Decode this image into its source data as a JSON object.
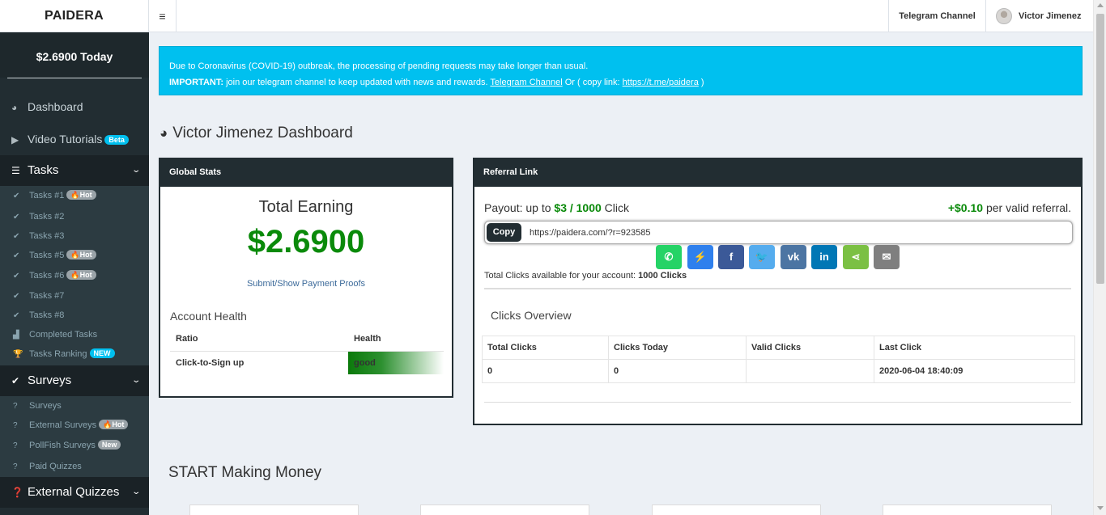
{
  "header": {
    "brand": "PAIDERA",
    "menu_icon": "hamburger-icon",
    "telegram_channel": "Telegram Channel",
    "user_name": "Victor Jimenez"
  },
  "sidebar": {
    "balance": "$2.6900 Today",
    "dashboard": "Dashboard",
    "video_tutorials": "Video Tutorials",
    "video_badge": "Beta",
    "tasks_section": "Tasks",
    "tasks": [
      {
        "label": "Tasks #1",
        "badge": "Hot"
      },
      {
        "label": "Tasks #2",
        "badge": ""
      },
      {
        "label": "Tasks #3",
        "badge": ""
      },
      {
        "label": "Tasks #5",
        "badge": "Hot"
      },
      {
        "label": "Tasks #6",
        "badge": "Hot"
      },
      {
        "label": "Tasks #7",
        "badge": ""
      },
      {
        "label": "Tasks #8",
        "badge": ""
      },
      {
        "label": "Completed Tasks",
        "badge": ""
      },
      {
        "label": "Tasks Ranking",
        "badge": "NEW"
      }
    ],
    "surveys_section": "Surveys",
    "surveys": [
      {
        "label": "Surveys",
        "badge": ""
      },
      {
        "label": "External Surveys",
        "badge": "Hot"
      },
      {
        "label": "PollFish Surveys",
        "badge": "New"
      },
      {
        "label": "Paid Quizzes",
        "badge": ""
      }
    ],
    "external_quizzes_section": "External Quizzes",
    "colors": {
      "bg": "#222d32",
      "section_bg": "#1a2226",
      "badge_blue": "#00c0ef"
    }
  },
  "alert": {
    "line1": "Due to Coronavirus (COVID-19) outbreak, the processing of pending requests may take longer than usual.",
    "important_label": "IMPORTANT:",
    "line2_text": " join our telegram channel to keep updated with news and rewards. ",
    "telegram_link": "Telegram Channel",
    "copy_text": " Or ( copy link: ",
    "copy_link": "https://t.me/paidera",
    "close_paren": " )",
    "color": "#00c0ef"
  },
  "dashboard": {
    "title": "Victor Jimenez Dashboard"
  },
  "global_stats": {
    "header": "Global Stats",
    "total_earning_label": "Total Earning",
    "total_earning_value": "$2.6900",
    "proofs_link": "Submit/Show Payment Proofs",
    "account_health_title": "Account Health",
    "columns": [
      "Ratio",
      "Health"
    ],
    "rows": [
      {
        "ratio": "Click-to-Sign up",
        "health": "good"
      }
    ]
  },
  "referral": {
    "header": "Referral Link",
    "payout_prefix": "Payout: up to ",
    "payout_value": "$3 / 1000",
    "payout_suffix": " Click",
    "per_ref_value": "+$0.10",
    "per_ref_suffix": " per valid referral.",
    "copy_button": "Copy",
    "link_value": "https://paidera.com/?r=923585",
    "share_buttons": [
      {
        "name": "whatsapp-icon",
        "color": "#25d366",
        "glyph": "✆"
      },
      {
        "name": "messenger-icon",
        "color": "#2f80ed",
        "glyph": "⚡"
      },
      {
        "name": "facebook-icon",
        "color": "#3b5998",
        "glyph": "f"
      },
      {
        "name": "twitter-icon",
        "color": "#55acee",
        "glyph": "🐦"
      },
      {
        "name": "vk-icon",
        "color": "#4c75a3",
        "glyph": "vk"
      },
      {
        "name": "linkedin-icon",
        "color": "#0077b5",
        "glyph": "in"
      },
      {
        "name": "share-icon",
        "color": "#7bc043",
        "glyph": "⋖"
      },
      {
        "name": "email-icon",
        "color": "#7f7f7f",
        "glyph": "✉"
      }
    ],
    "total_clicks_prefix": "Total Clicks available for your account: ",
    "total_clicks_value": "1000 Clicks",
    "clicks_overview_title": "Clicks Overview",
    "columns": [
      "Total Clicks",
      "Clicks Today",
      "Valid Clicks",
      "Last Click"
    ],
    "row": [
      "0",
      "0",
      "",
      "2020-06-04 18:40:09"
    ]
  },
  "start_section": {
    "title": "START Making Money"
  }
}
